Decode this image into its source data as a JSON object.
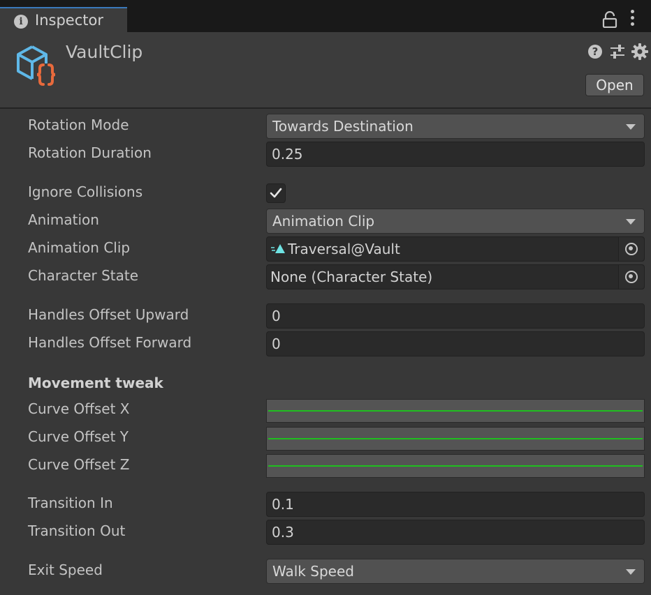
{
  "tab": {
    "label": "Inspector"
  },
  "header": {
    "title": "VaultClip",
    "open_label": "Open"
  },
  "fields": {
    "rotation_mode": {
      "label": "Rotation Mode",
      "value": "Towards Destination"
    },
    "rotation_duration": {
      "label": "Rotation Duration",
      "value": "0.25"
    },
    "ignore_collisions": {
      "label": "Ignore Collisions",
      "checked": true
    },
    "animation": {
      "label": "Animation",
      "value": "Animation Clip"
    },
    "animation_clip": {
      "label": "Animation Clip",
      "value": "Traversal@Vault"
    },
    "character_state": {
      "label": "Character State",
      "value": "None (Character State)"
    },
    "handles_offset_upward": {
      "label": "Handles Offset Upward",
      "value": "0"
    },
    "handles_offset_forward": {
      "label": "Handles Offset Forward",
      "value": "0"
    },
    "movement_tweak": {
      "label": "Movement tweak"
    },
    "curve_offset_x": {
      "label": "Curve Offset X"
    },
    "curve_offset_y": {
      "label": "Curve Offset Y"
    },
    "curve_offset_z": {
      "label": "Curve Offset Z"
    },
    "transition_in": {
      "label": "Transition In",
      "value": "0.1"
    },
    "transition_out": {
      "label": "Transition Out",
      "value": "0.3"
    },
    "exit_speed": {
      "label": "Exit Speed",
      "value": "Walk Speed"
    }
  },
  "icons": {
    "tab": "info-icon",
    "lock": "lock-icon",
    "menu": "kebab-menu-icon",
    "asset": "script-cube-icon",
    "help": "help-icon",
    "presets": "sliders-icon",
    "settings": "gear-icon",
    "clip": "animation-clip-icon",
    "picker": "object-picker-icon"
  },
  "colors": {
    "panel_bg": "#383838",
    "tab_bar_bg": "#191919",
    "active_tab_accent": "#3a79bb",
    "curve_line": "#1fbf1f",
    "asset_icon_cube": "#5fb8e8",
    "asset_icon_braces": "#e86a3c",
    "clip_icon": "#6fe3e3"
  }
}
